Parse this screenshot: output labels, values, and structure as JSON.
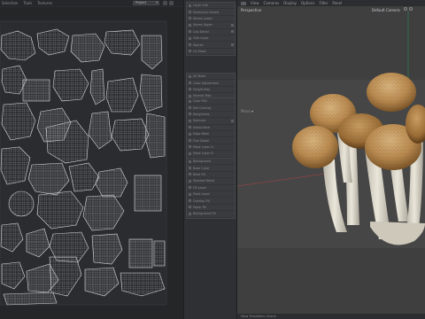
{
  "uv_editor": {
    "menu": [
      "Selection",
      "Tools",
      "Textures"
    ],
    "project_label": "Project"
  },
  "layers": {
    "group1": [
      "Layer Info",
      "Mushroom Heads",
      "Stems Lower",
      "Stems Upper",
      "Cap Detail",
      "Gills Layer",
      "Spores",
      "UV Mask"
    ],
    "group2": [
      "AO Bake",
      "Color Adjustment",
      "Height Map",
      "Normal Map"
    ],
    "group3": [
      "Color Mix",
      "Dirt Overlay",
      "Roughness",
      "Specular",
      "Subsurface",
      "Edge Wear",
      "Fine Detail",
      "Mask Layer A",
      "Mask Layer B",
      "Mask Layer C"
    ],
    "group4": [
      "Background",
      "Base Color",
      "Base Fill",
      "Shadow Blend",
      "Fill Layer",
      "Paint Layer",
      "Overlay Fill",
      "Paper Fill",
      "Background Fill"
    ]
  },
  "viewport": {
    "menu": [
      "View",
      "Cameras",
      "Display",
      "Options",
      "Filter",
      "Panel"
    ],
    "projection_label": "Perspective",
    "camera_label": "Default Camera",
    "world_label": "Move",
    "status_text": "View Transform: Scene"
  },
  "colors": {
    "uv_background": "#252628",
    "uv_wire": "#cfd2d6",
    "viewport_bg": "#3f3f3f",
    "cap_light": "#c9a26b",
    "cap_dark": "#8a6234",
    "stem": "#e4e0d4",
    "axis_red": "#b04040",
    "axis_green": "#2f8a5a"
  }
}
